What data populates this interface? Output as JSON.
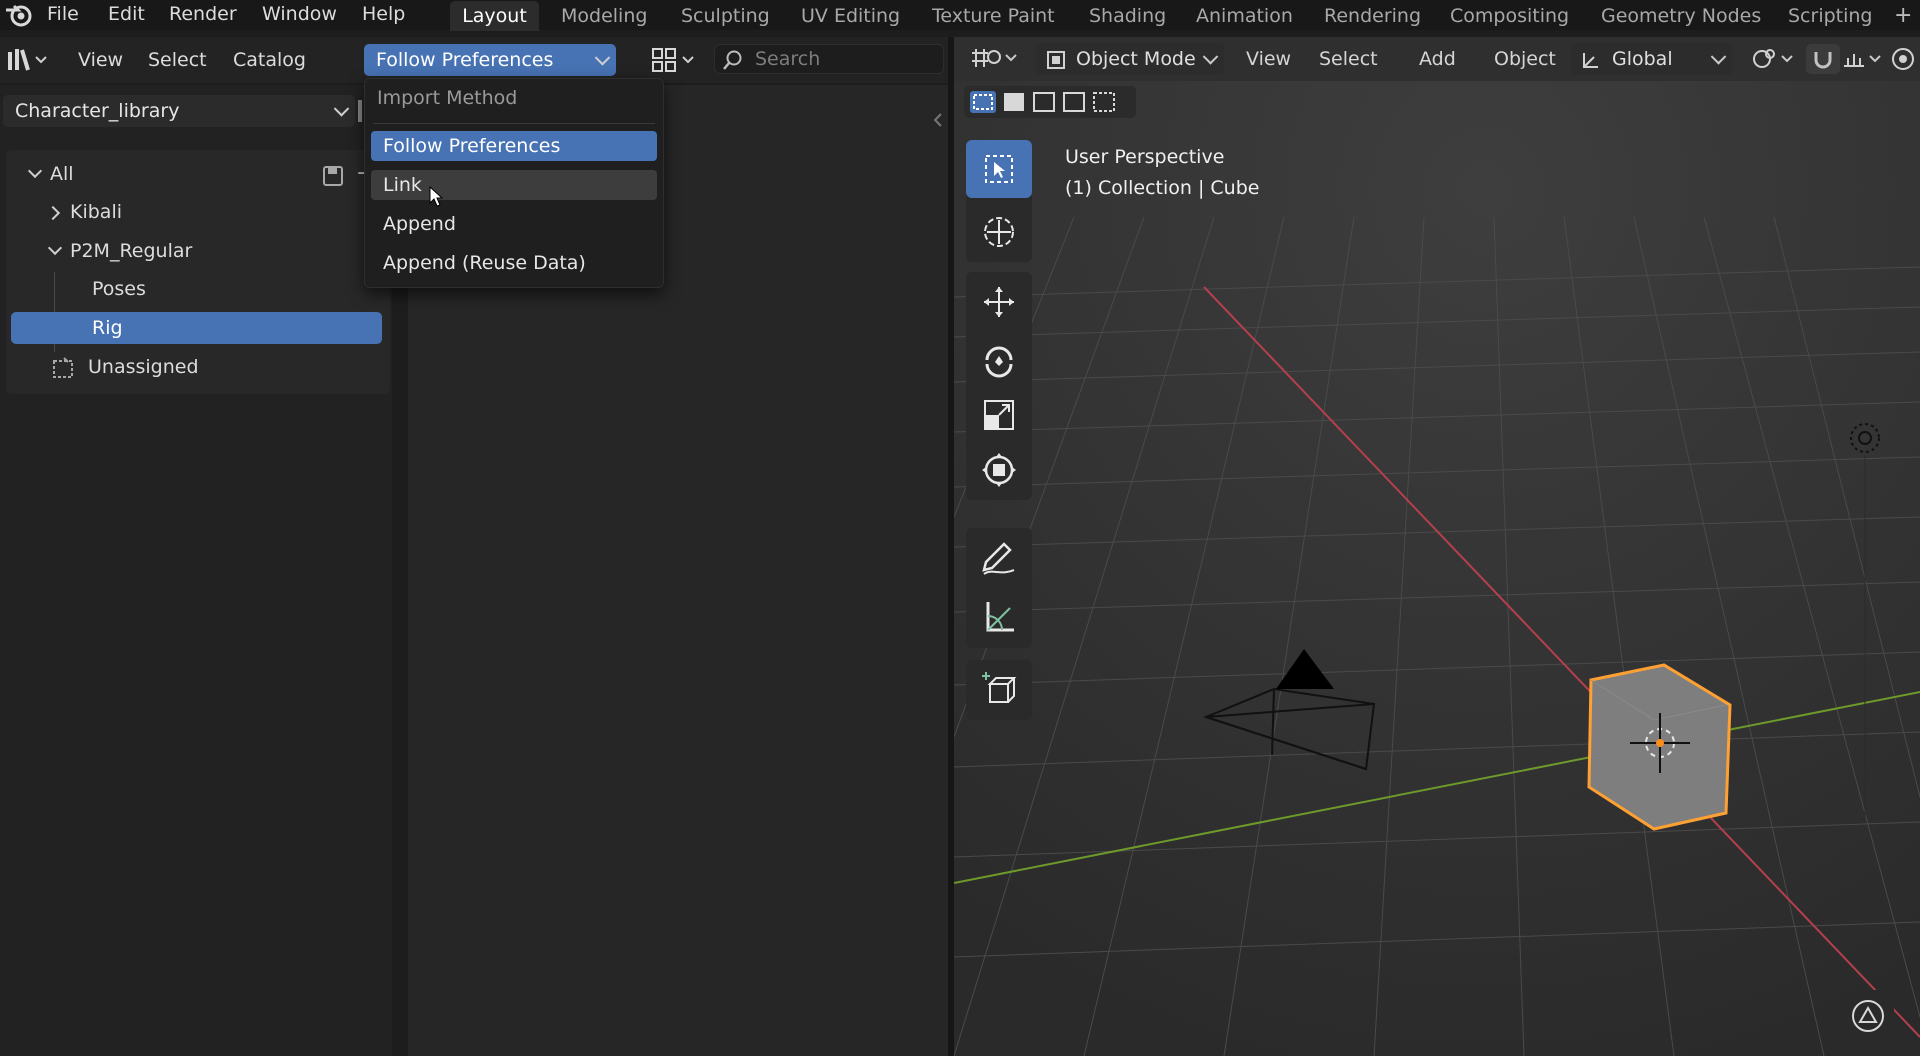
{
  "topbar": {
    "menus": [
      "File",
      "Edit",
      "Render",
      "Window",
      "Help"
    ],
    "workspaces": [
      "Layout",
      "Modeling",
      "Sculpting",
      "UV Editing",
      "Texture Paint",
      "Shading",
      "Animation",
      "Rendering",
      "Compositing",
      "Geometry Nodes",
      "Scripting"
    ],
    "active_workspace": "Layout",
    "add_tab": "+"
  },
  "asset_browser": {
    "header": {
      "menus": [
        "View",
        "Select",
        "Catalog"
      ],
      "import_method_value": "Follow Preferences",
      "search_placeholder": "Search"
    },
    "library": "Character_library",
    "catalog_tree": [
      {
        "label": "All",
        "expanded": true
      },
      {
        "label": "Kibali",
        "expanded": false
      },
      {
        "label": "P2M_Regular",
        "expanded": true
      },
      {
        "label": "Poses"
      },
      {
        "label": "Rig",
        "selected": true
      },
      {
        "label": "Unassigned"
      }
    ]
  },
  "import_menu": {
    "title": "Import Method",
    "items": [
      "Follow Preferences",
      "Link",
      "Append",
      "Append (Reuse Data)"
    ],
    "active_item": "Follow Preferences",
    "hovered_item": "Link"
  },
  "viewport": {
    "header": {
      "mode": "Object Mode",
      "menus": [
        "View",
        "Select",
        "Add",
        "Object"
      ],
      "orientation": "Global"
    },
    "overlay": {
      "perspective": "User Perspective",
      "collection_info": "(1) Collection | Cube"
    },
    "colors": {
      "x_axis": "#b3404c",
      "y_axis": "#6d9a2a",
      "selection_outline": "#ffa033",
      "accent": "#4772b3"
    }
  }
}
